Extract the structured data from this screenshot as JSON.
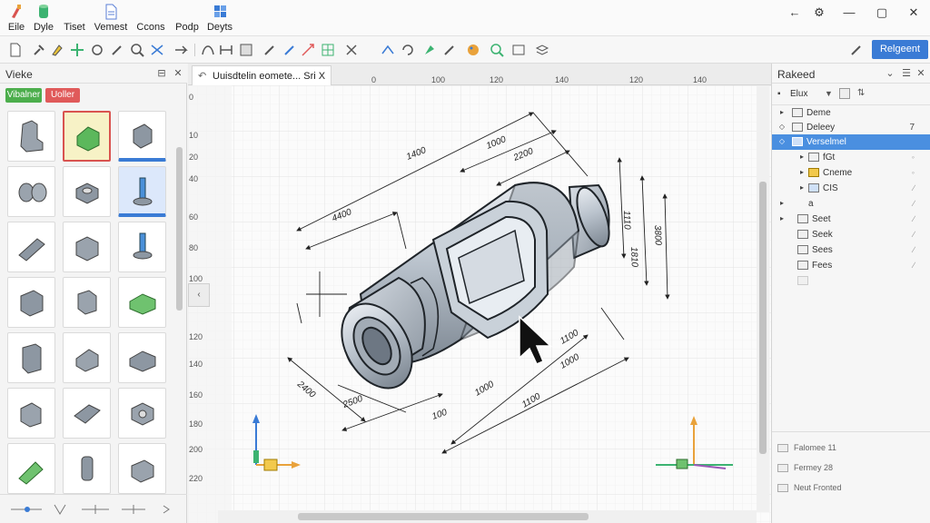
{
  "menu": {
    "items": [
      {
        "label": "Eile",
        "icon": "paint-brush-icon",
        "color": "#d9534f"
      },
      {
        "label": "Dyle",
        "icon": "green-cylinder-icon",
        "color": "#3cb371"
      },
      {
        "label": "Tiset",
        "icon": "document-icon",
        "color": "#e0a030"
      },
      {
        "label": "Vemest",
        "icon": "document-icon",
        "color": "#5b7fd6"
      },
      {
        "label": "Ccons",
        "icon": "document-icon",
        "color": "#5b7fd6"
      },
      {
        "label": "Podp",
        "icon": "document-icon",
        "color": "#5b7fd6"
      },
      {
        "label": "Deyts",
        "icon": "blocks-icon",
        "color": "#3a7bd5"
      }
    ],
    "window_controls": [
      "←",
      "⚙",
      "—",
      "▢",
      "✕"
    ]
  },
  "toolbar": {
    "primary_label": "Relgeent"
  },
  "left_panel": {
    "title": "Vieke",
    "chips": [
      {
        "label": "Vibalner",
        "color": "#4cae4c"
      },
      {
        "label": "Uoller",
        "color": "#e05a5a"
      }
    ]
  },
  "document": {
    "tab_label": "Uuisdtelin eomete... Sri X"
  },
  "canvas": {
    "ruler_top": [
      "0",
      "100",
      "120",
      "140",
      "120",
      "140"
    ],
    "ruler_left": [
      "0",
      "10",
      "20",
      "40",
      "60",
      "80",
      "100",
      "120",
      "140",
      "160",
      "180",
      "200",
      "220"
    ],
    "dimensions": [
      "1400",
      "1000",
      "2200",
      "4400",
      "1110",
      "1810",
      "3800",
      "1100",
      "1000",
      "2400",
      "2500",
      "100",
      "1000",
      "1100"
    ]
  },
  "right_panel": {
    "title": "Rakeed",
    "filter_label": "Elux",
    "tree": [
      {
        "label": "Deme",
        "count": "",
        "indent": 0,
        "arrow": "▸",
        "selected": false
      },
      {
        "label": "Deleey",
        "count": "7",
        "indent": 0,
        "arrow": "◇",
        "selected": false
      },
      {
        "label": "Verselmel",
        "count": "",
        "indent": 0,
        "arrow": "◇",
        "selected": true
      },
      {
        "label": "fGt",
        "count": "",
        "indent": 2,
        "arrow": "▸",
        "selected": false
      },
      {
        "label": "Cneme",
        "count": "",
        "indent": 2,
        "arrow": "▸",
        "selected": false
      },
      {
        "label": "CIS",
        "count": "",
        "indent": 2,
        "arrow": "▸",
        "selected": false
      },
      {
        "label": "a",
        "count": "",
        "indent": 1,
        "arrow": "▸",
        "selected": false
      },
      {
        "label": "Seet",
        "count": "",
        "indent": 1,
        "arrow": "▸",
        "selected": false
      },
      {
        "label": "Seek",
        "count": "",
        "indent": 1,
        "arrow": "",
        "selected": false
      },
      {
        "label": "Sees",
        "count": "",
        "indent": 1,
        "arrow": "",
        "selected": false
      },
      {
        "label": "Fees",
        "count": "",
        "indent": 1,
        "arrow": "",
        "selected": false
      },
      {
        "label": "",
        "count": "",
        "indent": 1,
        "arrow": "",
        "selected": false
      }
    ],
    "layers": [
      {
        "label": "Falomee 11"
      },
      {
        "label": "Fermey 28"
      },
      {
        "label": "Neut Fronted"
      }
    ]
  }
}
